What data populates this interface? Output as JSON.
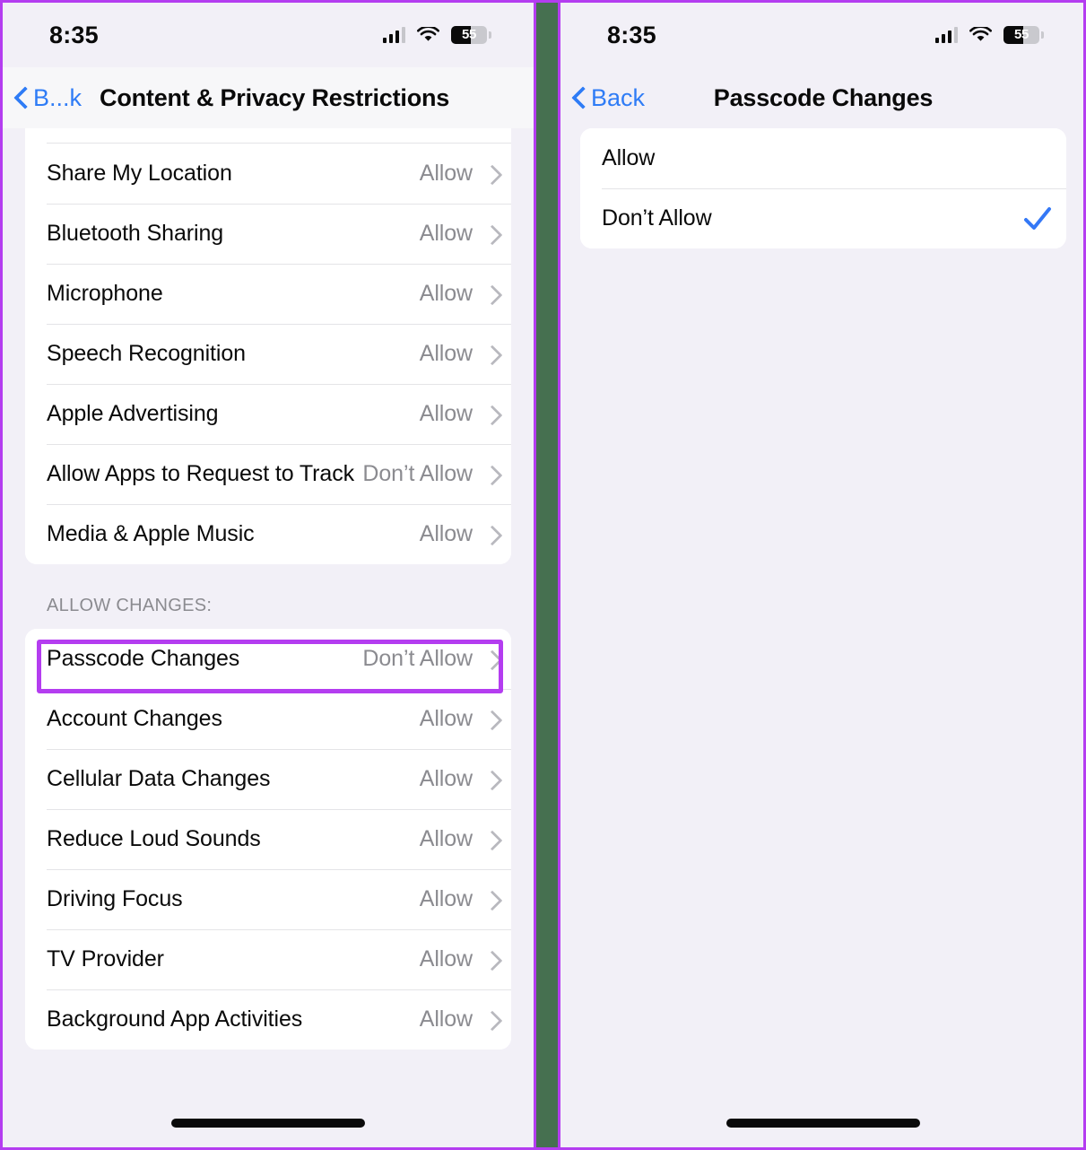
{
  "theme": {
    "accent_purple": "#b43df0",
    "ios_blue": "#2f7cf6",
    "check_blue": "#3478f6",
    "background": "#f2f0f7",
    "card": "#ffffff",
    "secondary_text": "#8b8b90",
    "divider_green": "#467050"
  },
  "left_phone": {
    "status_bar": {
      "time": "8:35",
      "battery_percent": "55",
      "cellular_icon": "cellular-bars-icon",
      "wifi_icon": "wifi-icon",
      "battery_icon": "battery-icon"
    },
    "nav": {
      "back_label": "B...k",
      "back_icon": "chevron-left-icon",
      "title": "Content & Privacy Restrictions"
    },
    "section_one_rows": [
      {
        "label": "Share My Location",
        "value": "Allow"
      },
      {
        "label": "Bluetooth Sharing",
        "value": "Allow"
      },
      {
        "label": "Microphone",
        "value": "Allow"
      },
      {
        "label": "Speech Recognition",
        "value": "Allow"
      },
      {
        "label": "Apple Advertising",
        "value": "Allow"
      },
      {
        "label": "Allow Apps to Request to Track",
        "value": "Don’t Allow"
      },
      {
        "label": "Media & Apple Music",
        "value": "Allow"
      }
    ],
    "section_two_header": "ALLOW CHANGES:",
    "section_two_rows": [
      {
        "label": "Passcode Changes",
        "value": "Don’t Allow"
      },
      {
        "label": "Account Changes",
        "value": "Allow"
      },
      {
        "label": "Cellular Data Changes",
        "value": "Allow"
      },
      {
        "label": "Reduce Loud Sounds",
        "value": "Allow"
      },
      {
        "label": "Driving Focus",
        "value": "Allow"
      },
      {
        "label": "TV Provider",
        "value": "Allow"
      },
      {
        "label": "Background App Activities",
        "value": "Allow"
      }
    ]
  },
  "right_phone": {
    "status_bar": {
      "time": "8:35",
      "battery_percent": "55",
      "cellular_icon": "cellular-bars-icon",
      "wifi_icon": "wifi-icon",
      "battery_icon": "battery-icon"
    },
    "nav": {
      "back_label": "Back",
      "back_icon": "chevron-left-icon",
      "title": "Passcode Changes"
    },
    "options": [
      {
        "label": "Allow",
        "selected": false
      },
      {
        "label": "Don’t Allow",
        "selected": true
      }
    ]
  },
  "annotations": {
    "highlight_target": "Passcode Changes",
    "arrow_target": "Allow",
    "color": "#b43df0"
  }
}
